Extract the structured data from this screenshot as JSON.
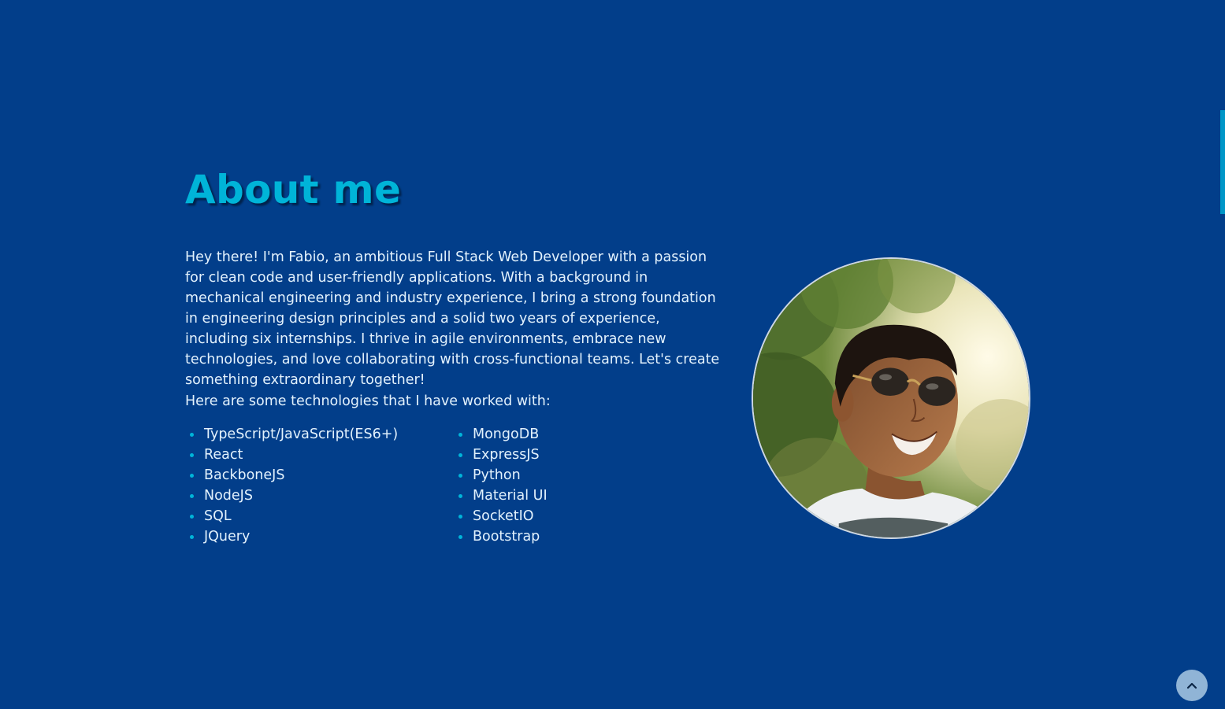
{
  "about": {
    "title": "About me",
    "bio": "Hey there! I'm Fabio, an ambitious Full Stack Web Developer with a passion for clean code and user-friendly applications. With a background in mechanical engineering and industry experience, I bring a strong foundation in engineering design principles and a solid two years of experience, including six internships. I thrive in agile environments, embrace new technologies, and love collaborating with cross-functional teams. Let's create something extraordinary together!",
    "tech_intro": "Here are some technologies that I have worked with:",
    "tech_left": [
      "TypeScript/JavaScript(ES6+)",
      "React",
      "BackboneJS",
      "NodeJS",
      "SQL",
      "JQuery"
    ],
    "tech_right": [
      "MongoDB",
      "ExpressJS",
      "Python",
      "Material UI",
      "SocketIO",
      "Bootstrap"
    ]
  },
  "photo": {
    "icon": "profile-photo"
  },
  "back_to_top": {
    "icon": "chevron-up-icon"
  },
  "colors": {
    "background": "#023e8a",
    "accent": "#00b4d8",
    "text": "#e3f2fd"
  }
}
